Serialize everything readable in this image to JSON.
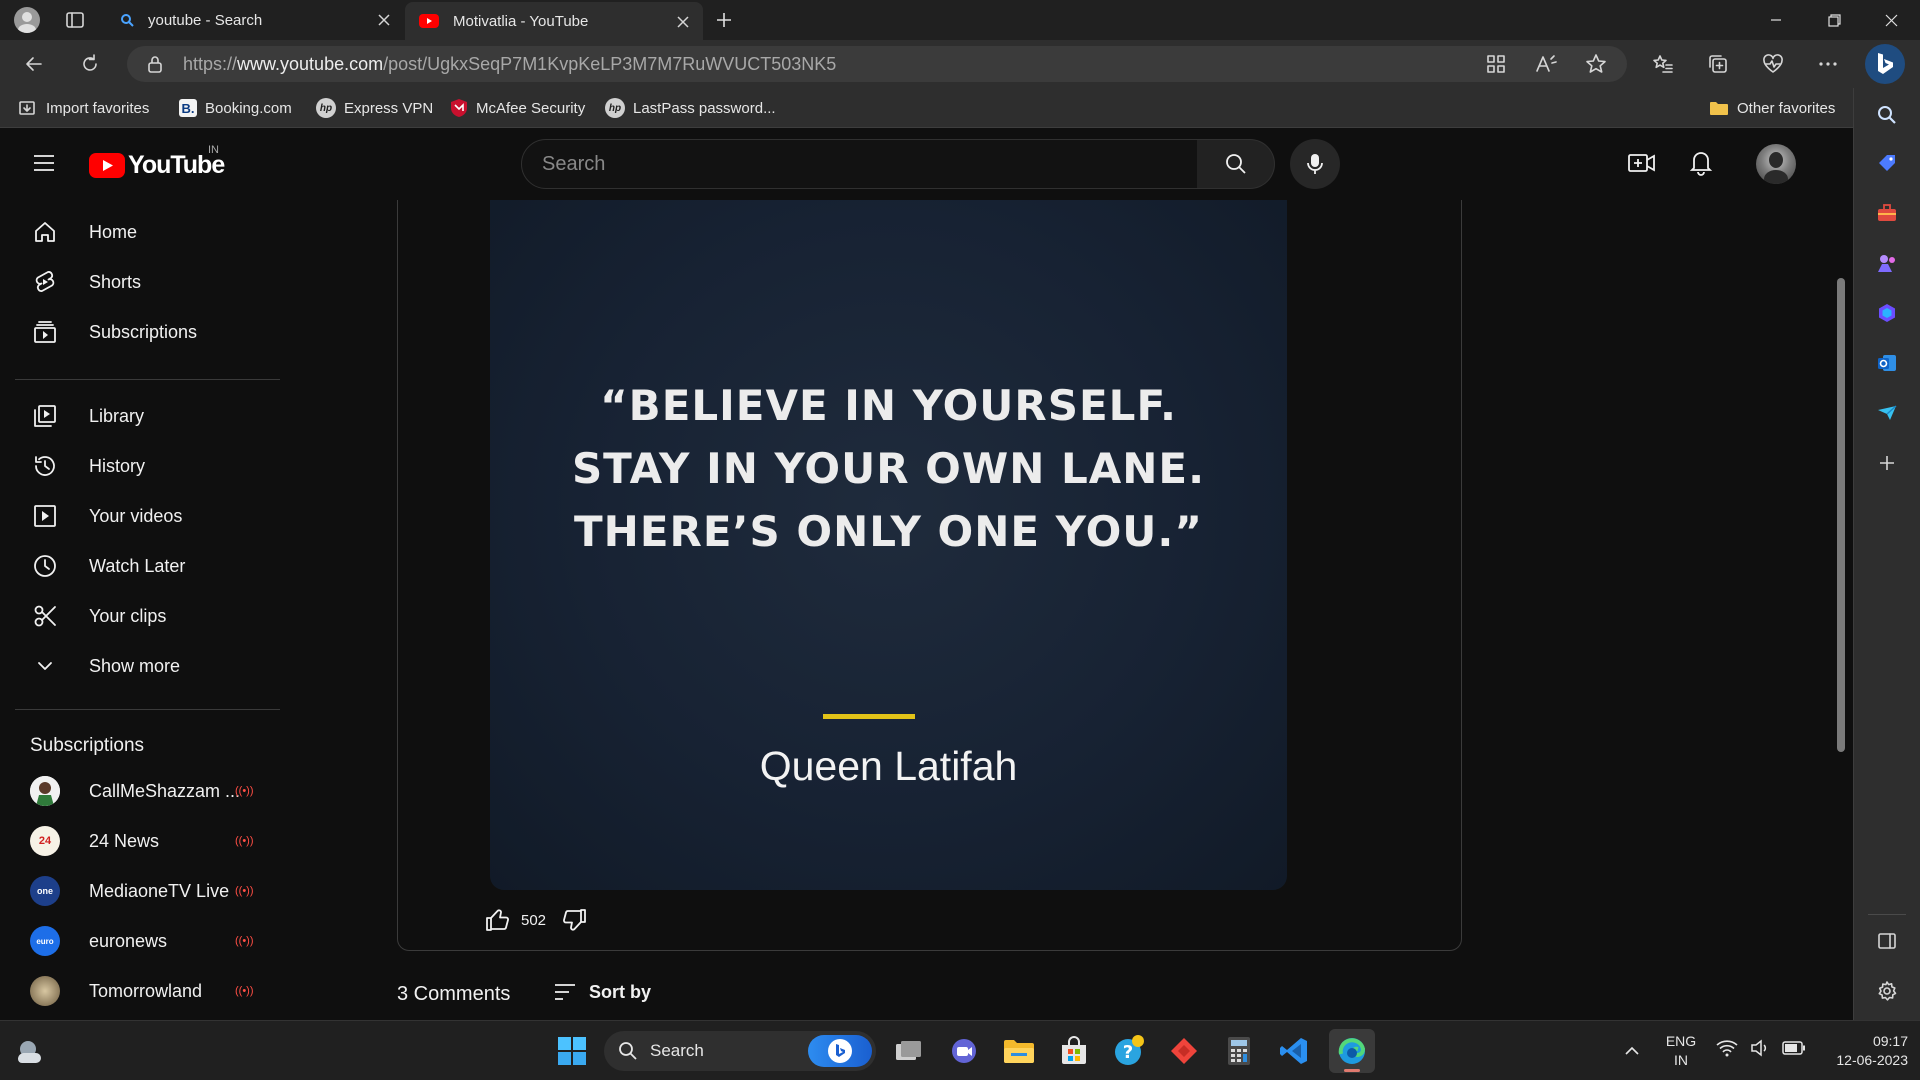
{
  "browser": {
    "tabs": [
      {
        "title": "youtube - Search",
        "active": false
      },
      {
        "title": "Motivatlia - YouTube",
        "active": true
      }
    ],
    "url_prefix": "https://",
    "url_domain": "www.youtube.com",
    "url_path": "/post/UgkxSeqP7M1KvpKeLP3M7M7RuWVUCT503NK5",
    "favorites": [
      "Import favorites",
      "Booking.com",
      "Express VPN",
      "McAfee Security",
      "LastPass password...",
      "Other favorites"
    ],
    "accent": "#1a73e8"
  },
  "youtube": {
    "logo_text": "YouTube",
    "country": "IN",
    "search_placeholder": "Search",
    "nav_primary": [
      "Home",
      "Shorts",
      "Subscriptions"
    ],
    "nav_library": [
      "Library",
      "History",
      "Your videos",
      "Watch Later",
      "Your clips",
      "Show more"
    ],
    "subscriptions_heading": "Subscriptions",
    "subscriptions": [
      {
        "name": "CallMeShazzam ...",
        "live": true
      },
      {
        "name": "24 News",
        "live": true
      },
      {
        "name": "MediaoneTV Live",
        "live": true
      },
      {
        "name": "euronews",
        "live": true
      },
      {
        "name": "Tomorrowland",
        "live": true
      }
    ],
    "brand_red": "#ff0000",
    "post": {
      "quote_lines": [
        "“BELIEVE IN YOURSELF.",
        "STAY IN YOUR OWN LANE.",
        "THERE’S ONLY ONE YOU.”"
      ],
      "author": "Queen Latifah",
      "likes": "502",
      "comments_count": "3 Comments",
      "sort_label": "Sort by"
    }
  },
  "taskbar": {
    "search_label": "Search",
    "lang_top": "ENG",
    "lang_bottom": "IN",
    "time": "09:17",
    "date": "12-06-2023"
  }
}
